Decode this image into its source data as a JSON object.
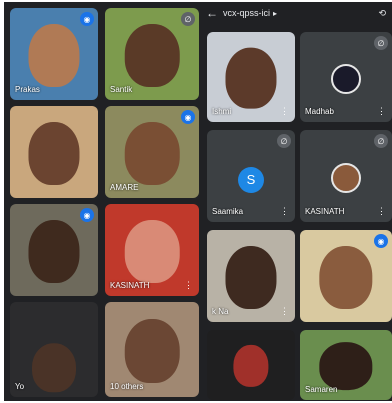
{
  "call_header": {
    "back_icon": "arrow-left-icon",
    "meeting_code": "vcx-qpss-ici",
    "dropdown_icon": "chevron-right-icon",
    "mic_icon": "mic-icon",
    "camera_switch_icon": "camera-switch-icon"
  },
  "left_screen": {
    "tiles": [
      {
        "name": "Prakas",
        "badge": "speaking"
      },
      {
        "name": "Santik",
        "badge": "muted"
      },
      {
        "name": ""
      },
      {
        "name": "",
        "badge": "speaking"
      },
      {
        "name": "",
        "badge": "speaking"
      },
      {
        "name": "AMARE",
        "badge": "speaking"
      },
      {
        "name": "",
        "badge": "speaking"
      },
      {
        "name": "KASINATH"
      },
      {
        "name": "Yo"
      },
      {
        "name": "10 others"
      }
    ]
  },
  "right_screen": {
    "tiles": [
      {
        "name": "Ishmi"
      },
      {
        "name": "Madhab",
        "badge": "muted"
      },
      {
        "name": "Saamika",
        "avatar_letter": "S",
        "badge": "muted"
      },
      {
        "name": "KASINATH",
        "badge": "muted"
      },
      {
        "name": "k Na"
      },
      {
        "name": ""
      },
      {
        "name": ""
      },
      {
        "name": "Samaren"
      }
    ]
  },
  "colors": {
    "background": "#202124",
    "accent": "#1a73e8",
    "muted_badge": "#5f6368"
  }
}
